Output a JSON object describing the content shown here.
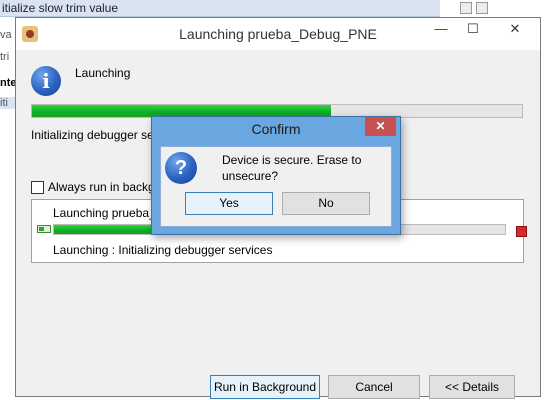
{
  "background": {
    "top_text": "itialize slow trim value",
    "left_fragments": [
      "va",
      "tri",
      "nte",
      "iti"
    ]
  },
  "window": {
    "title": "Launching prueba_Debug_PNE",
    "minimize": "—",
    "maximize": "☐",
    "close": "✕"
  },
  "main": {
    "heading": "Launching",
    "progress": 0.61,
    "status_text": "Initializing debugger se",
    "always_run_label": "Always run in backg"
  },
  "job": {
    "name": "Launching prueba_",
    "progress": 0.39,
    "status": "Launching : Initializing debugger services"
  },
  "buttons": {
    "run_in_background": "Run in Background",
    "cancel": "Cancel",
    "details": "<< Details"
  },
  "confirm": {
    "title": "Confirm",
    "close": "✕",
    "message": "Device is secure. Erase to unsecure?",
    "yes": "Yes",
    "no": "No"
  },
  "colors": {
    "progress_green": "#06b025",
    "dialog_frame": "#6aa7e0",
    "close_red": "#c75050"
  }
}
